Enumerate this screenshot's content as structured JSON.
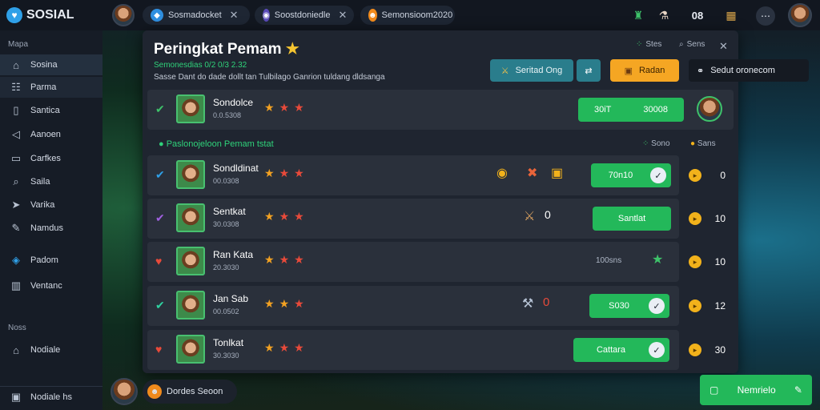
{
  "app": {
    "logo_text": "SOSIAL"
  },
  "topbar": {
    "tabs": [
      {
        "label": "Sosmadocket"
      },
      {
        "label": "Soostdoniedle"
      },
      {
        "label": "Semonsioom2020"
      }
    ],
    "right_badge": "08"
  },
  "sidebar": {
    "section1": "Mapa",
    "items": [
      {
        "label": "Sosina",
        "icon": "home-icon"
      },
      {
        "label": "Parma",
        "icon": "users-icon"
      },
      {
        "label": "Santica",
        "icon": "book-icon"
      },
      {
        "label": "Aanoen",
        "icon": "megaphone-icon"
      },
      {
        "label": "Carfkes",
        "icon": "inbox-icon"
      },
      {
        "label": "Saila",
        "icon": "search-icon"
      },
      {
        "label": "Varika",
        "icon": "paperplane-icon"
      },
      {
        "label": "Namdus",
        "icon": "wrench-icon"
      },
      {
        "label": "Padom",
        "icon": "shield-icon"
      },
      {
        "label": "Ventanc",
        "icon": "chart-icon"
      }
    ],
    "section2": "Noss",
    "items2": [
      {
        "label": "Nodiale",
        "icon": "bank-icon"
      }
    ],
    "footer": "Nodiale hs"
  },
  "modal": {
    "title": "Peringkat Pemam",
    "subtitle1": "Semonesdias 0/2 0/3 2.32",
    "subtitle2": "Sasse Dant do dade dollt tan Tulbilago Ganrion tuldang dldsanga",
    "top_actions": {
      "left_label": "Stes",
      "right_label": "Sens"
    },
    "buttons": {
      "teal": "Seritad Ong",
      "orange": "Radan",
      "dark": "Sedut oronecom"
    },
    "pinned": {
      "name": "Sondolce",
      "meta": "0.0.5308",
      "action_left": "30iT",
      "action_right": "30008"
    },
    "section_label": "Paslonojeloon Pemam tstat",
    "section_right_1": "Sono",
    "section_right_2": "Sans",
    "rows": [
      {
        "name": "Sondldinat",
        "meta": "00.0308",
        "button": "70n10",
        "score": "0"
      },
      {
        "name": "Sentkat",
        "meta": "30.0308",
        "button": "Santlat",
        "score": "10",
        "mid_value": "0"
      },
      {
        "name": "Ran Kata",
        "meta": "20.3030",
        "button": "",
        "score": "10",
        "mid_text": "100sns"
      },
      {
        "name": "Jan Sab",
        "meta": "00.0502",
        "button": "S030",
        "score": "12",
        "mid_value": "0"
      },
      {
        "name": "Tonlkat",
        "meta": "30.3030",
        "button": "Cattara",
        "score": "30"
      }
    ]
  },
  "bottom": {
    "chip": "Dordes Seoon",
    "cta": "Nemrielo"
  },
  "colors": {
    "accent": "#23b85a",
    "orange": "#f5a623",
    "teal": "#2a7d8c",
    "gold": "#f2b21b"
  }
}
